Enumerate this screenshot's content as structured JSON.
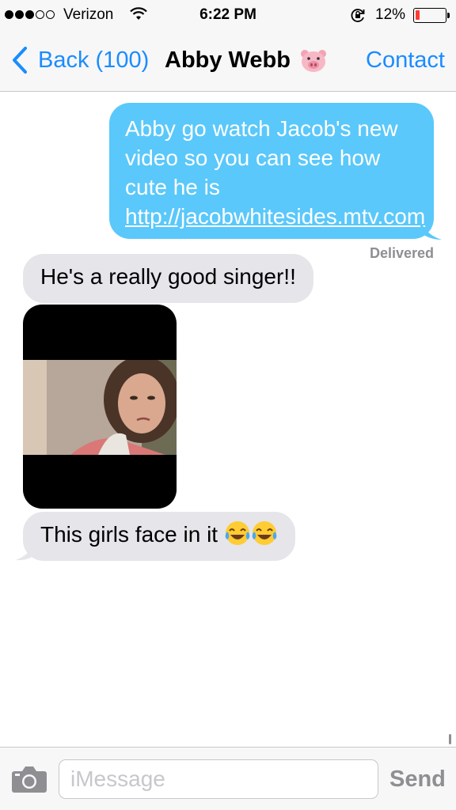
{
  "status_bar": {
    "carrier": "Verizon",
    "time": "6:22 PM",
    "battery_percent": "12%",
    "battery_level": 0.12,
    "signal_bars_filled": 3,
    "signal_bars_total": 5,
    "icons": [
      "wifi-icon",
      "rotation-lock-icon",
      "battery-icon"
    ]
  },
  "nav": {
    "back_label": "Back (100)",
    "title": "Abby Webb",
    "title_emoji": "pig-face-emoji",
    "contact_label": "Contact"
  },
  "messages": [
    {
      "direction": "outgoing",
      "text": "Abby go watch Jacob's new video so you can see how cute he is ",
      "link": "http://jacobwhitesides.mtv.com"
    },
    {
      "direction": "status",
      "text": "Delivered"
    },
    {
      "direction": "incoming",
      "text": "He's a really good singer!!"
    },
    {
      "direction": "incoming",
      "type": "video",
      "thumbnail": "video-thumbnail"
    },
    {
      "direction": "incoming",
      "text": "This girls face in it ",
      "emoji": [
        "face-with-tears-of-joy-emoji",
        "face-with-tears-of-joy-emoji"
      ]
    }
  ],
  "input_bar": {
    "placeholder": "iMessage",
    "value": "",
    "send_label": "Send",
    "camera_icon": "camera-icon"
  },
  "colors": {
    "accent_blue": "#1a8cff",
    "outgoing_bubble": "#5ac8fa",
    "incoming_bubble": "#e5e5ea",
    "bar_background": "#f7f7f7",
    "delivered_gray": "#8e8e93",
    "battery_red": "#ff3b30"
  }
}
